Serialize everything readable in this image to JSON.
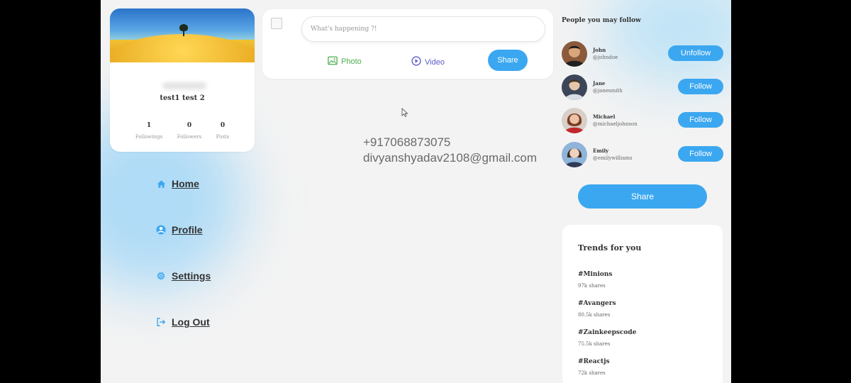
{
  "profile": {
    "name": "test1 test 2",
    "stats": [
      {
        "value": "1",
        "label": "Followings"
      },
      {
        "value": "0",
        "label": "Followers"
      },
      {
        "value": "0",
        "label": "Posts"
      }
    ]
  },
  "nav": {
    "home": "Home",
    "profile": "Profile",
    "settings": "Settings",
    "logout": "Log Out"
  },
  "composer": {
    "placeholder": "What's happening ?!",
    "photo": "Photo",
    "video": "Video",
    "share": "Share"
  },
  "contact": {
    "phone": "+917068873075",
    "email": "divyanshyadav2108@gmail.com"
  },
  "follow": {
    "title": "People you may follow",
    "people": [
      {
        "name": "John",
        "handle": "@johndoe",
        "action": "Unfollow"
      },
      {
        "name": "Jane",
        "handle": "@janesmith",
        "action": "Follow"
      },
      {
        "name": "Michael",
        "handle": "@michaeljohnson",
        "action": "Follow"
      },
      {
        "name": "Emily",
        "handle": "@emilywilliams",
        "action": "Follow"
      }
    ],
    "share": "Share"
  },
  "trends": {
    "title": "Trends for you",
    "items": [
      {
        "tag": "#Minions",
        "shares": "97k shares"
      },
      {
        "tag": "#Avangers",
        "shares": "80.5k shares"
      },
      {
        "tag": "#Zainkeepscode",
        "shares": "75.5k shares"
      },
      {
        "tag": "#Reactjs",
        "shares": "72k shares"
      }
    ]
  },
  "colors": {
    "accent": "#3ba7f0",
    "photo": "#4caf50",
    "video": "#5a5ac8"
  }
}
